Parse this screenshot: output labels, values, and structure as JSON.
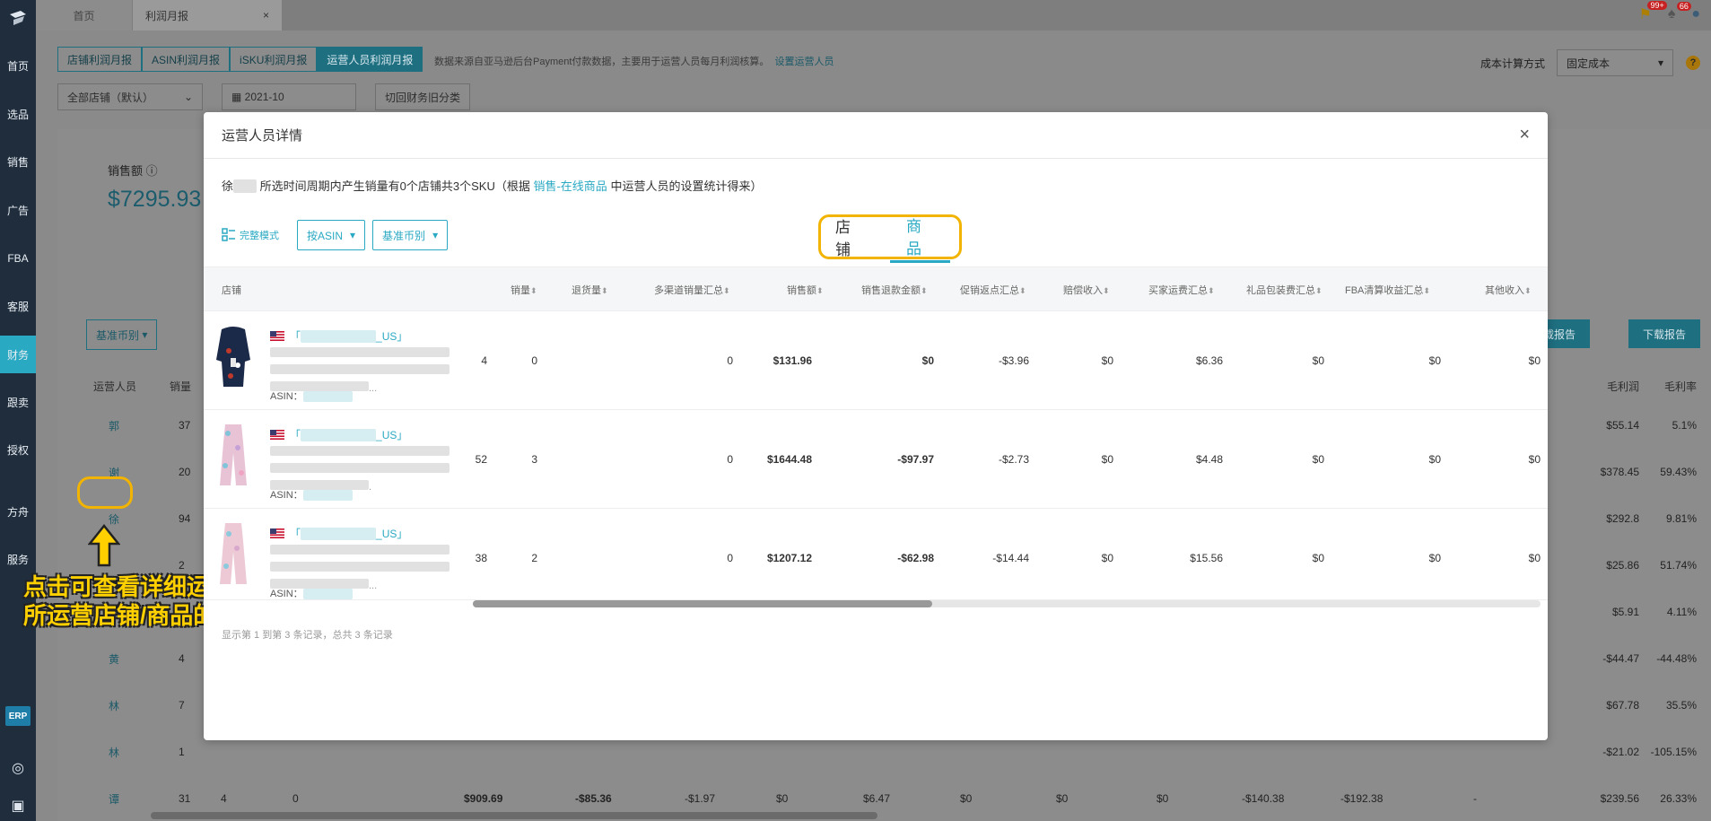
{
  "nav": {
    "items": [
      "首页",
      "选品",
      "销售",
      "广告",
      "FBA",
      "客服",
      "财务",
      "跟卖",
      "授权",
      "方舟",
      "服务"
    ],
    "active_index": 6,
    "erp_label": "ERP"
  },
  "top_tabs": {
    "home": "首页",
    "current": "利润月报",
    "close": "×"
  },
  "top_badges": {
    "flag": "99+",
    "bell": "66"
  },
  "page": {
    "subtabs": [
      "店铺利润月报",
      "ASIN利润月报",
      "iSKU利润月报",
      "运营人员利润月报"
    ],
    "note": "数据来源自亚马逊后台Payment付款数据，主要用于运营人员每月利润核算。",
    "note_link": "设置运营人员",
    "cost_label": "成本计算方式",
    "cost_value": "固定成本",
    "help": "?",
    "store_filter": "全部店铺（默认）",
    "month": "2021-10",
    "switch_btn": "切回财务旧分类",
    "sales_label": "销售额",
    "sales_value": "$7295.93",
    "currency_btn": "基准币别",
    "export_btn": "下载报告",
    "export_btn2": "载报告",
    "col_operator": "运营人员",
    "col_sales": "销量",
    "col_gross": "毛利润",
    "col_rate": "毛利率",
    "rows": [
      {
        "name": "郭",
        "qty": "37",
        "gross": "$55.14",
        "rate": "5.1%"
      },
      {
        "name": "谢",
        "qty": "20",
        "gross": "$378.45",
        "rate": "59.43%"
      },
      {
        "name": "徐",
        "qty": "94",
        "gross": "$292.8",
        "rate": "9.81%"
      },
      {
        "name": "",
        "qty": "2",
        "gross": "$25.86",
        "rate": "51.74%"
      },
      {
        "name": "",
        "qty": "",
        "gross": "$5.91",
        "rate": "4.11%"
      },
      {
        "name": "黄",
        "qty": "4",
        "gross": "-$44.47",
        "rate": "-44.48%"
      },
      {
        "name": "林",
        "qty": "7",
        "gross": "$67.78",
        "rate": "35.5%"
      },
      {
        "name": "林",
        "qty": "1",
        "gross": "-$21.02",
        "rate": "-105.15%"
      },
      {
        "name": "谭",
        "qty": "31",
        "gross": "$239.56",
        "rate": "26.33%"
      }
    ],
    "last_row_extra": [
      "4",
      "0",
      "$909.69",
      "-$85.36",
      "-$1.97",
      "$0",
      "$6.47",
      "$0",
      "$0",
      "$0",
      "-$140.38",
      "-$192.38",
      "-"
    ]
  },
  "callout": {
    "line1": "点击可查看详细运营人员",
    "line2": "所运营店铺/商品的情况"
  },
  "modal": {
    "title": "运营人员详情",
    "close": "×",
    "desc_name": "徐",
    "desc_text": "所选时间周期内产生销量有0个店铺共3个SKU（根据",
    "desc_link": "销售-在线商品",
    "desc_tail": "中运营人员的设置统计得来）",
    "full_mode": "完整模式",
    "by_asin": "按ASIN",
    "currency": "基准币别",
    "seg_store": "店铺",
    "seg_product": "商品",
    "headers": [
      "店铺",
      "销量",
      "退货量",
      "多渠道销量汇总",
      "销售额",
      "销售退款金额",
      "促销返点汇总",
      "赔偿收入",
      "买家运费汇总",
      "礼品包装费汇总",
      "FBA清算收益汇总",
      "其他收入"
    ],
    "asin_label": "ASIN：",
    "store_suffix": "_US」",
    "rows": [
      {
        "qty": "4",
        "ret": "0",
        "mcf": "0",
        "sales": "$131.96",
        "refund": "$0",
        "promo": "-$3.96",
        "comp": "$0",
        "ship": "$6.36",
        "gift": "$0",
        "fba": "$0",
        "other": "$0"
      },
      {
        "qty": "52",
        "ret": "3",
        "mcf": "0",
        "sales": "$1644.48",
        "refund": "-$97.97",
        "promo": "-$2.73",
        "comp": "$0",
        "ship": "$4.48",
        "gift": "$0",
        "fba": "$0",
        "other": "$0"
      },
      {
        "qty": "38",
        "ret": "2",
        "mcf": "0",
        "sales": "$1207.12",
        "refund": "-$62.98",
        "promo": "-$14.44",
        "comp": "$0",
        "ship": "$15.56",
        "gift": "$0",
        "fba": "$0",
        "other": "$0"
      }
    ],
    "footer": "显示第 1 到第 3 条记录，总共 3 条记录"
  },
  "colors": {
    "accent": "#2aa9c3",
    "highlight": "#f2b400",
    "nav_bg": "#1f2d3d"
  }
}
